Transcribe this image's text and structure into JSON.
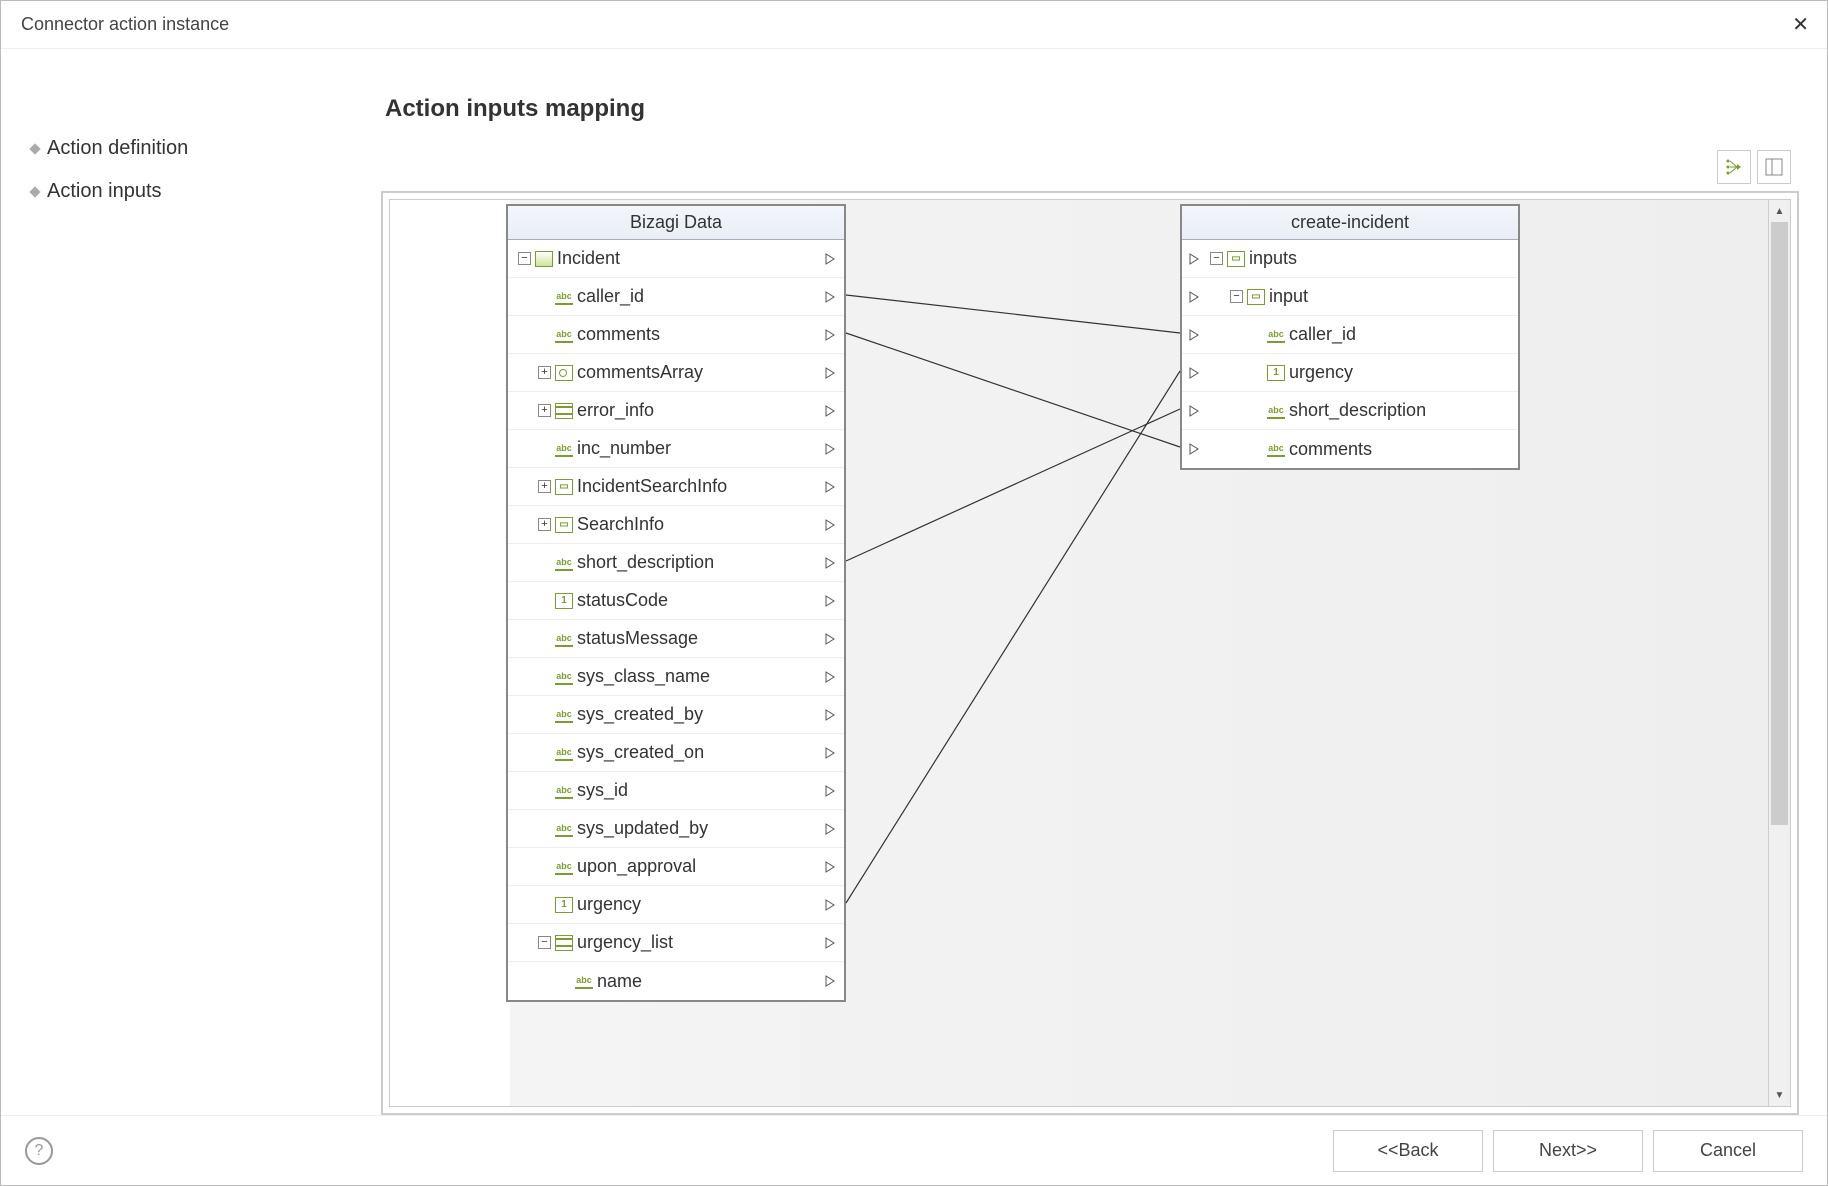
{
  "window": {
    "title": "Connector action instance"
  },
  "sidebar": {
    "items": [
      {
        "label": "Action definition"
      },
      {
        "label": "Action inputs"
      }
    ]
  },
  "main": {
    "heading": "Action inputs mapping"
  },
  "source_tree": {
    "header": "Bizagi Data",
    "rows": [
      {
        "label": "Incident",
        "type": "entity",
        "twist": "−",
        "indent": 0
      },
      {
        "label": "caller_id",
        "type": "abc",
        "indent": 1
      },
      {
        "label": "comments",
        "type": "abc",
        "indent": 1
      },
      {
        "label": "commentsArray",
        "type": "param",
        "twist": "+",
        "indent": 1
      },
      {
        "label": "error_info",
        "type": "table",
        "twist": "+",
        "indent": 1
      },
      {
        "label": "inc_number",
        "type": "abc",
        "indent": 1
      },
      {
        "label": "IncidentSearchInfo",
        "type": "box",
        "twist": "+",
        "indent": 1
      },
      {
        "label": "SearchInfo",
        "type": "box",
        "twist": "+",
        "indent": 1
      },
      {
        "label": "short_description",
        "type": "abc",
        "indent": 1
      },
      {
        "label": "statusCode",
        "type": "num",
        "indent": 1
      },
      {
        "label": "statusMessage",
        "type": "abc",
        "indent": 1
      },
      {
        "label": "sys_class_name",
        "type": "abc",
        "indent": 1
      },
      {
        "label": "sys_created_by",
        "type": "abc",
        "indent": 1
      },
      {
        "label": "sys_created_on",
        "type": "abc",
        "indent": 1
      },
      {
        "label": "sys_id",
        "type": "abc",
        "indent": 1
      },
      {
        "label": "sys_updated_by",
        "type": "abc",
        "indent": 1
      },
      {
        "label": "upon_approval",
        "type": "abc",
        "indent": 1
      },
      {
        "label": "urgency",
        "type": "num",
        "indent": 1
      },
      {
        "label": "urgency_list",
        "type": "table",
        "twist": "−",
        "indent": 1
      },
      {
        "label": "name",
        "type": "abc",
        "indent": 2
      }
    ]
  },
  "target_tree": {
    "header": "create-incident",
    "rows": [
      {
        "label": "inputs",
        "type": "box",
        "twist": "−",
        "indent": 0
      },
      {
        "label": "input",
        "type": "box",
        "twist": "−",
        "indent": 1
      },
      {
        "label": "caller_id",
        "type": "abc",
        "indent": 2
      },
      {
        "label": "urgency",
        "type": "num",
        "indent": 2
      },
      {
        "label": "short_description",
        "type": "abc",
        "indent": 2
      },
      {
        "label": "comments",
        "type": "abc",
        "indent": 2
      }
    ]
  },
  "connections": [
    {
      "from": 1,
      "to": 2
    },
    {
      "from": 2,
      "to": 5
    },
    {
      "from": 8,
      "to": 4
    },
    {
      "from": 17,
      "to": 3
    }
  ],
  "footer": {
    "back": "<<Back",
    "next": "Next>>",
    "cancel": "Cancel"
  }
}
